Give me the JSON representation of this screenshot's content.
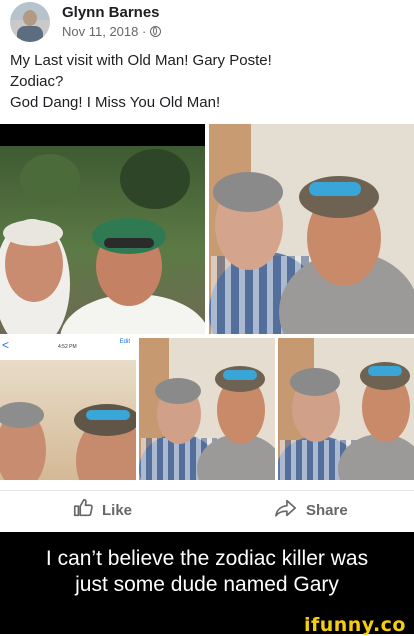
{
  "post": {
    "author": "Glynn Barnes",
    "date": "Nov 11, 2018 ·",
    "text_lines": [
      "My Last visit with Old Man! Gary Poste!",
      "Zodiac?",
      "God Dang! I Miss You Old Man!"
    ],
    "phone_screenshot": {
      "back": "<",
      "time": "4:52 PM",
      "edit": "Edit"
    }
  },
  "actions": {
    "like": "Like",
    "share": "Share"
  },
  "caption": {
    "line1": "I can’t believe the zodiac killer was",
    "line2": "just some dude named Gary"
  },
  "footer": {
    "brand": "ifunny.co"
  },
  "colors": {
    "background": "#ffffff",
    "caption_bg": "#000000",
    "brand_yellow": "#f5ce0f",
    "text": "#1c1e21",
    "muted": "#65676b"
  },
  "icons": {
    "privacy": "globe-icon",
    "like": "thumbs-up-icon",
    "share": "share-arrow-icon"
  }
}
